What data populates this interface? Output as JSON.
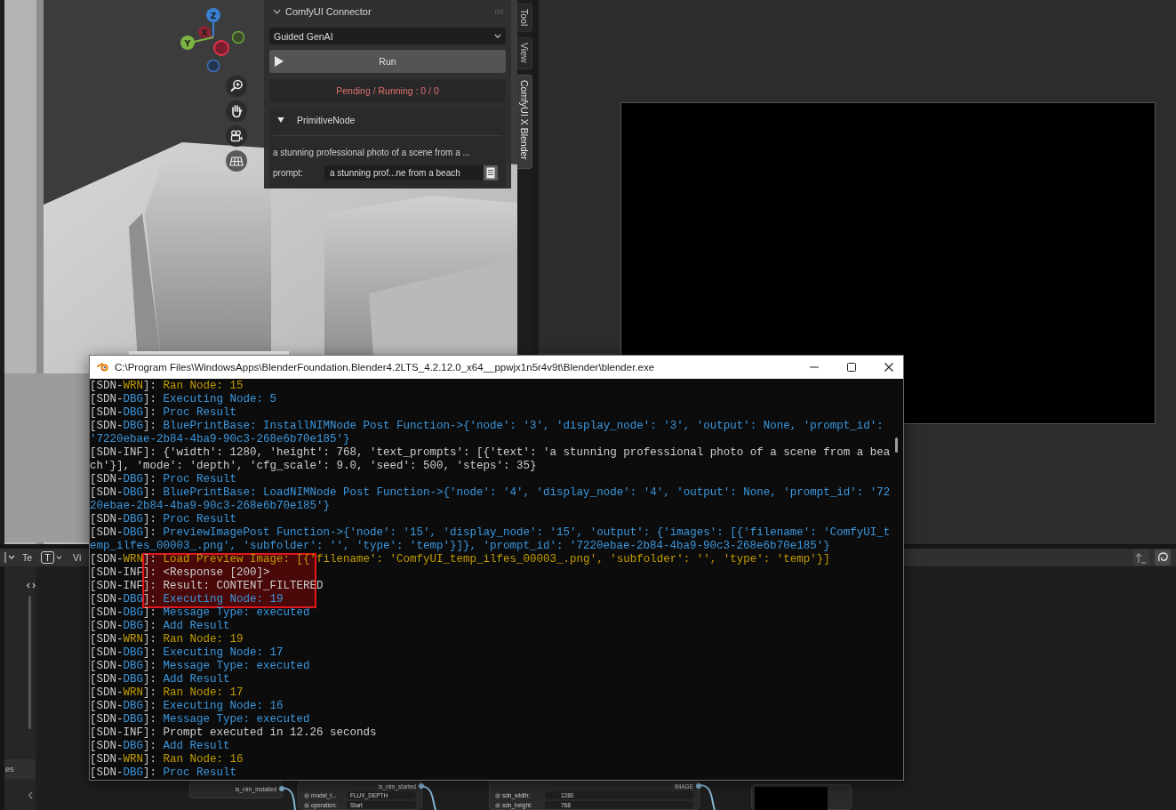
{
  "viewport": {
    "gizmo": {
      "z": "Z",
      "x": "X",
      "y": "Y"
    }
  },
  "panel": {
    "title": "ComfyUI Connector",
    "expanded": true,
    "dropdown": {
      "value": "Guided GenAI"
    },
    "run_button": {
      "label": "Run"
    },
    "status": "Pending / Running : 0 / 0",
    "subpanel": {
      "title": "PrimitiveNode",
      "expanded": true,
      "text": "a stunning professional photo of a scene from a ...",
      "field_label": "prompt:",
      "field_value": "a stunning prof...ne from a beach"
    }
  },
  "sidebar_tabs": [
    {
      "label": "Tool",
      "selected": false
    },
    {
      "label": "View",
      "selected": false
    },
    {
      "label": "ComfyUI X Blender",
      "selected": true
    }
  ],
  "bottom_header": {
    "editor_menu": "Te",
    "text_toggle": "T",
    "view_menu": "Vi"
  },
  "bottom_sidebar": {
    "label": "es"
  },
  "console": {
    "title": "C:\\Program Files\\WindowsApps\\BlenderFoundation.Blender4.2LTS_4.2.12.0_x64__ppwjx1n5r4v9t\\Blender\\blender.exe",
    "annotation": {
      "kind": "highlight-box"
    },
    "lines": [
      {
        "kind": "warn",
        "open": "[SDN-",
        "level": "WRN",
        "close": "]:",
        "message": "Ran Node: 15"
      },
      {
        "kind": "debug",
        "open": "[SDN-",
        "level": "DBG",
        "close": "]:",
        "message": "Executing Node: 5"
      },
      {
        "kind": "debug",
        "open": "[SDN-",
        "level": "DBG",
        "close": "]:",
        "message": "Proc Result"
      },
      {
        "kind": "debug",
        "open": "[SDN-",
        "level": "DBG",
        "close": "]:",
        "message": "BluePrintBase: InstallNIMNode Post Function->{'node': '3', 'display_node': '3', 'output': None, 'prompt_id':"
      },
      {
        "kind": "debug",
        "message": "'7220ebae-2b84-4ba9-90c3-268e6b70e185'}"
      },
      {
        "kind": "info",
        "open": "[SDN-",
        "level": "INF",
        "close": "]:",
        "message": "{'width': 1280, 'height': 768, 'text_prompts': [{'text': 'a stunning professional photo of a scene from a bea"
      },
      {
        "kind": "info",
        "message": "ch'}], 'mode': 'depth', 'cfg_scale': 9.0, 'seed': 500, 'steps': 35}"
      },
      {
        "kind": "debug",
        "open": "[SDN-",
        "level": "DBG",
        "close": "]:",
        "message": "Proc Result"
      },
      {
        "kind": "debug",
        "open": "[SDN-",
        "level": "DBG",
        "close": "]:",
        "message": "BluePrintBase: LoadNIMNode Post Function->{'node': '4', 'display_node': '4', 'output': None, 'prompt_id': '72"
      },
      {
        "kind": "debug",
        "message": "20ebae-2b84-4ba9-90c3-268e6b70e185'}"
      },
      {
        "kind": "debug",
        "open": "[SDN-",
        "level": "DBG",
        "close": "]:",
        "message": "Proc Result"
      },
      {
        "kind": "debug",
        "open": "[SDN-",
        "level": "DBG",
        "close": "]:",
        "message": "PreviewImagePost Function->{'node': '15', 'display_node': '15', 'output': {'images': [{'filename': 'ComfyUI_t"
      },
      {
        "kind": "debug",
        "message": "emp_ilfes_00003_.png', 'subfolder': '', 'type': 'temp'}]}, 'prompt_id': '7220ebae-2b84-4ba9-90c3-268e6b70e185'}"
      },
      {
        "kind": "warn",
        "open": "[SDN-",
        "level": "WRN",
        "close": "]:",
        "message": "Load Preview Image: [{'filename': 'ComfyUI_temp_ilfes_00003_.png', 'subfolder': '', 'type': 'temp'}]"
      },
      {
        "kind": "info",
        "open": "[SDN-",
        "level": "INF",
        "close": "]:",
        "message": "<Response [200]>"
      },
      {
        "kind": "info",
        "open": "[SDN-",
        "level": "INF",
        "close": "]:",
        "message": "Result: CONTENT_FILTERED"
      },
      {
        "kind": "debug",
        "open": "[SDN-",
        "level": "DBG",
        "close": "]:",
        "message": "Executing Node: 19"
      },
      {
        "kind": "debug",
        "open": "[SDN-",
        "level": "DBG",
        "close": "]:",
        "message": "Message Type: executed"
      },
      {
        "kind": "debug",
        "open": "[SDN-",
        "level": "DBG",
        "close": "]:",
        "message": "Add Result"
      },
      {
        "kind": "warn",
        "open": "[SDN-",
        "level": "WRN",
        "close": "]:",
        "message": "Ran Node: 19"
      },
      {
        "kind": "debug",
        "open": "[SDN-",
        "level": "DBG",
        "close": "]:",
        "message": "Executing Node: 17"
      },
      {
        "kind": "debug",
        "open": "[SDN-",
        "level": "DBG",
        "close": "]:",
        "message": "Message Type: executed"
      },
      {
        "kind": "debug",
        "open": "[SDN-",
        "level": "DBG",
        "close": "]:",
        "message": "Add Result"
      },
      {
        "kind": "warn",
        "open": "[SDN-",
        "level": "WRN",
        "close": "]:",
        "message": "Ran Node: 17"
      },
      {
        "kind": "debug",
        "open": "[SDN-",
        "level": "DBG",
        "close": "]:",
        "message": "Executing Node: 16"
      },
      {
        "kind": "debug",
        "open": "[SDN-",
        "level": "DBG",
        "close": "]:",
        "message": "Message Type: executed"
      },
      {
        "kind": "info",
        "open": "[SDN-",
        "level": "INF",
        "close": "]:",
        "message": "Prompt executed in 12.26 seconds"
      },
      {
        "kind": "debug",
        "open": "[SDN-",
        "level": "DBG",
        "close": "]:",
        "message": "Add Result"
      },
      {
        "kind": "warn",
        "open": "[SDN-",
        "level": "WRN",
        "close": "]:",
        "message": "Ran Node: 16"
      },
      {
        "kind": "debug",
        "open": "[SDN-",
        "level": "DBG",
        "close": "]:",
        "message": "Proc Result"
      }
    ]
  },
  "nodes": [
    {
      "kind": "output",
      "output": "is_nim_installed"
    },
    {
      "kind": "widgets",
      "output": "is_nim_started",
      "widgets": [
        {
          "label": "model_t...",
          "value": "FLUX_DEPTH"
        },
        {
          "label": "operation:",
          "value": "Start"
        }
      ]
    },
    {
      "kind": "widgets",
      "output": "IMAGE",
      "widgets": [
        {
          "label": "sdn_width:",
          "value": "1280"
        },
        {
          "label": "sdn_height:",
          "value": "768"
        }
      ]
    },
    {
      "kind": "preview"
    }
  ]
}
